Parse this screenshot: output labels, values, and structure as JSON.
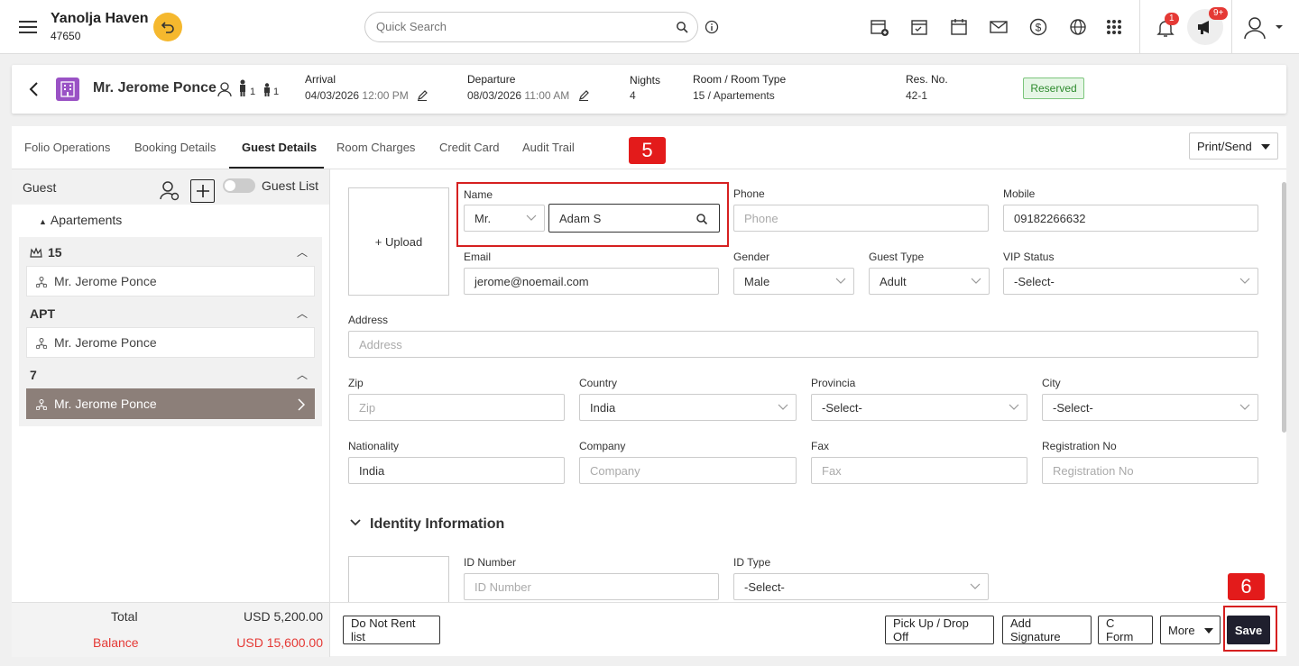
{
  "topbar": {
    "hotel_name": "Yanolja Haven",
    "hotel_id": "47650",
    "search_placeholder": "Quick Search",
    "notification_count": "1",
    "announce_count": "9+"
  },
  "reservation": {
    "guest_name": "Mr. Jerome Ponce",
    "adults": "1",
    "children": "1",
    "arrival_label": "Arrival",
    "arrival_date": "04/03/2026",
    "arrival_time": "12:00 PM",
    "departure_label": "Departure",
    "departure_date": "08/03/2026",
    "departure_time": "11:00 AM",
    "nights_label": "Nights",
    "nights": "4",
    "room_label": "Room / Room Type",
    "room": "15 / Apartements",
    "resno_label": "Res. No.",
    "resno": "42-1",
    "status": "Reserved",
    "status_color": "#2e8b2e"
  },
  "tabs": [
    "Folio Operations",
    "Booking Details",
    "Guest Details",
    "Room Charges",
    "Credit Card",
    "Audit Trail"
  ],
  "print_send": "Print/Send",
  "markers": {
    "step5": "5",
    "step6": "6"
  },
  "sidebar": {
    "title": "Guest",
    "guest_list_label": "Guest List",
    "room_type": "Apartements",
    "groups": [
      {
        "title": "15",
        "guest": "Mr. Jerome Ponce"
      },
      {
        "title": "APT",
        "guest": "Mr. Jerome Ponce"
      },
      {
        "title": "7",
        "guest": "Mr. Jerome Ponce"
      }
    ]
  },
  "form": {
    "upload_label": "+ Upload",
    "name_label": "Name",
    "salutation": "Mr.",
    "name_value": "Adam S",
    "phone_label": "Phone",
    "phone_placeholder": "Phone",
    "mobile_label": "Mobile",
    "mobile_value": "09182266632",
    "email_label": "Email",
    "email_value": "jerome@noemail.com",
    "gender_label": "Gender",
    "gender_value": "Male",
    "guest_type_label": "Guest Type",
    "guest_type_value": "Adult",
    "vip_label": "VIP Status",
    "vip_value": "-Select-",
    "address_label": "Address",
    "address_placeholder": "Address",
    "zip_label": "Zip",
    "zip_placeholder": "Zip",
    "country_label": "Country",
    "country_value": "India",
    "provincia_label": "Provincia",
    "provincia_value": "-Select-",
    "city_label": "City",
    "city_value": "-Select-",
    "nationality_label": "Nationality",
    "nationality_value": "India",
    "company_label": "Company",
    "company_placeholder": "Company",
    "fax_label": "Fax",
    "fax_placeholder": "Fax",
    "regno_label": "Registration No",
    "regno_placeholder": "Registration No",
    "identity_title": "Identity Information",
    "id_number_label": "ID Number",
    "id_number_placeholder": "ID Number",
    "id_type_label": "ID Type",
    "id_type_value": "-Select-"
  },
  "footer": {
    "total_label": "Total",
    "total_value": "USD 5,200.00",
    "balance_label": "Balance",
    "balance_value": "USD 15,600.00",
    "balance_color": "#e53935",
    "do_not_rent": "Do Not Rent list",
    "pickup": "Pick Up / Drop Off",
    "signature": "Add Signature",
    "cform": "C Form",
    "more": "More",
    "save": "Save"
  }
}
